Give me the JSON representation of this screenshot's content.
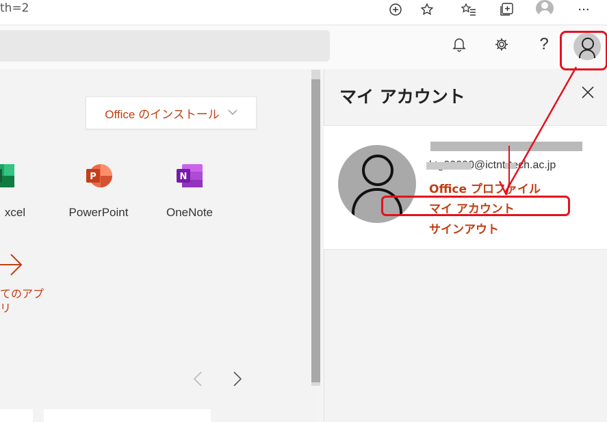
{
  "browser": {
    "address_text": "th=2",
    "icons": [
      "add-tab-icon",
      "favorite-star-icon",
      "favorites-list-icon",
      "collections-icon",
      "profile-icon",
      "more-icon"
    ],
    "more_label": "···"
  },
  "header": {
    "icons": [
      "bell-icon",
      "gear-icon",
      "help-icon",
      "account-avatar-icon"
    ],
    "help_label": "?"
  },
  "main": {
    "install_button": "Office のインストール",
    "apps": [
      {
        "label": "Excel",
        "shown_label": "xcel",
        "color": "#1d6f42"
      },
      {
        "label": "PowerPoint",
        "color": "#d24726"
      },
      {
        "label": "OneNote",
        "color": "#7719aa"
      }
    ],
    "all_apps_line1": "てのアプ",
    "all_apps_line2": "リ",
    "prev_label": "‹",
    "next_label": "›"
  },
  "account_panel": {
    "title": "マイ アカウント",
    "close_label": "×",
    "email": "ktg00000@ictnt-tech.ac.jp",
    "links": [
      "Office プロファイル",
      "マイ アカウント",
      "サインアウト"
    ]
  },
  "colors": {
    "accent": "#c13e12",
    "annotation": "#e6101e"
  }
}
